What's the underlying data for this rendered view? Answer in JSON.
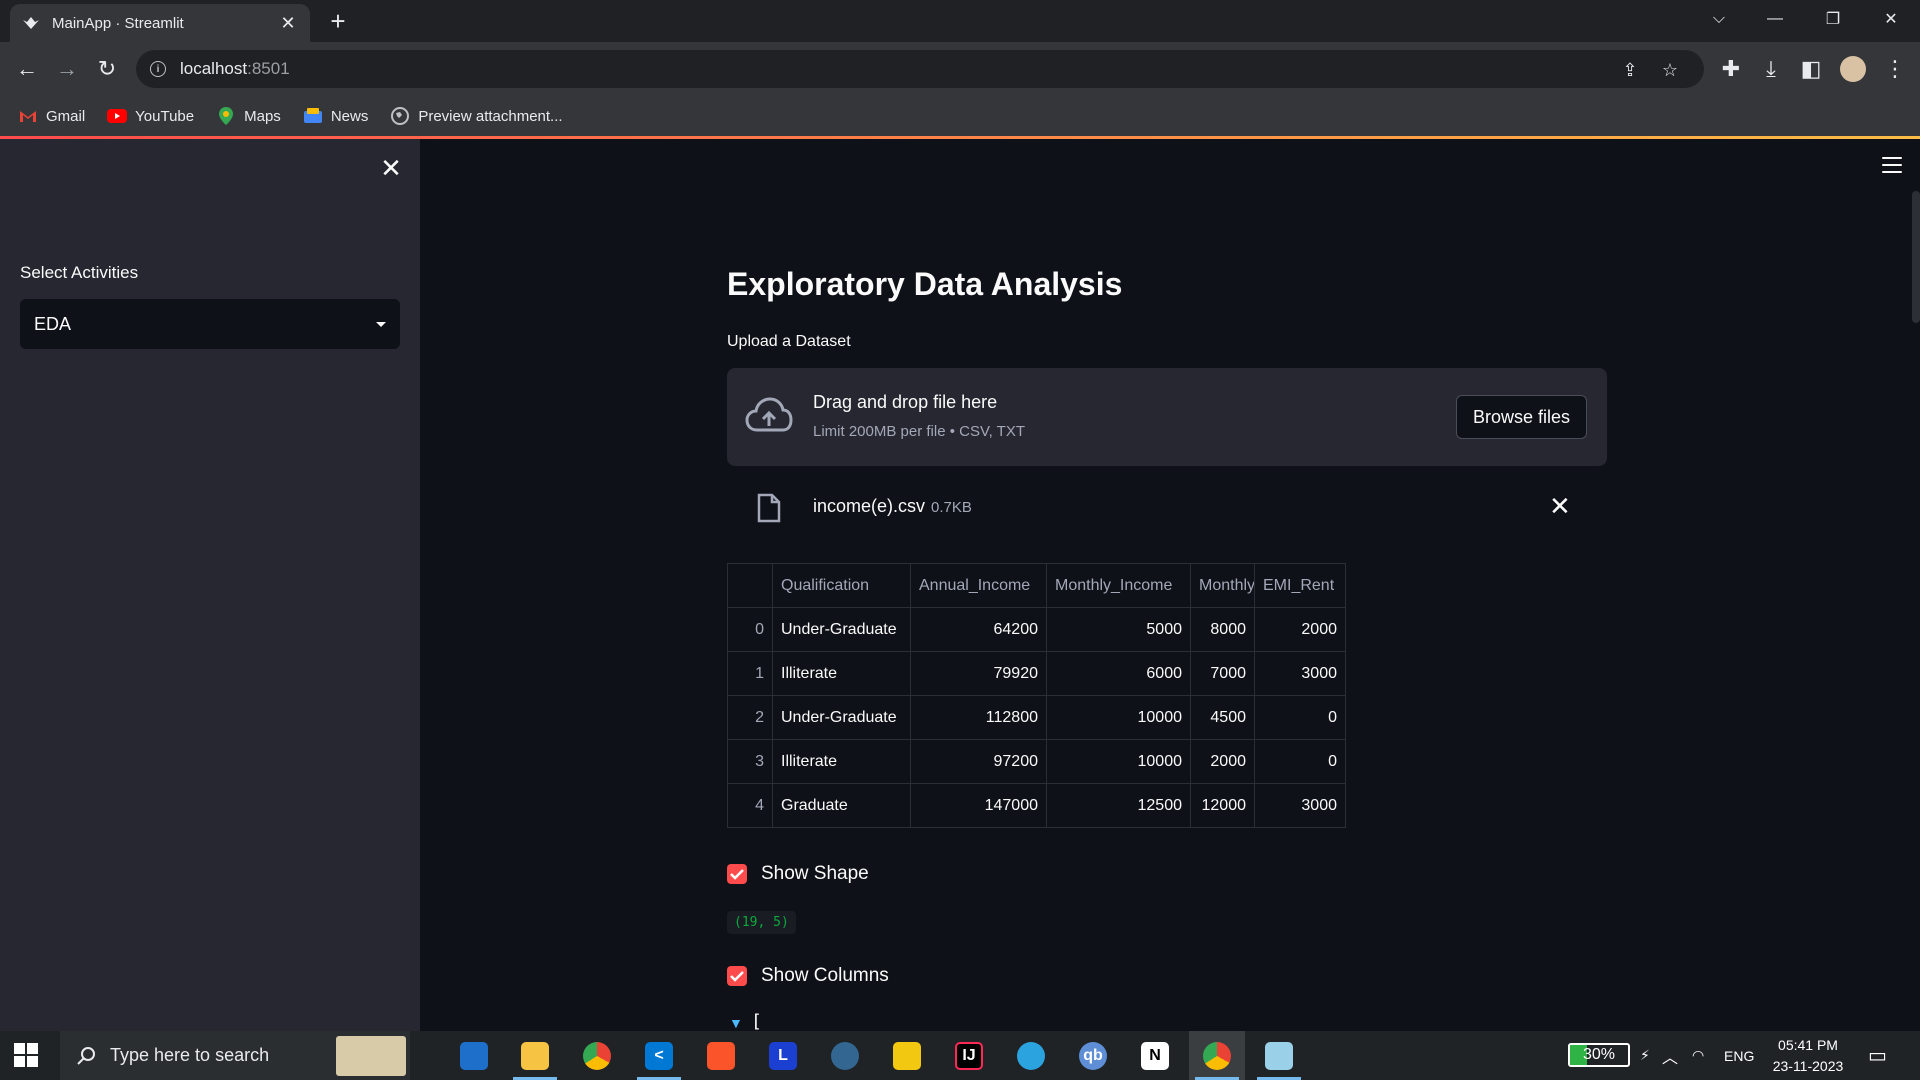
{
  "browser": {
    "tab_title": "MainApp · Streamlit",
    "url_host": "localhost",
    "url_port": ":8501",
    "bookmarks": [
      {
        "label": "Gmail",
        "icon": "gmail-icon"
      },
      {
        "label": "YouTube",
        "icon": "youtube-icon"
      },
      {
        "label": "Maps",
        "icon": "maps-icon"
      },
      {
        "label": "News",
        "icon": "news-icon"
      },
      {
        "label": "Preview attachment...",
        "icon": "globe-icon"
      }
    ]
  },
  "sidebar": {
    "select_label": "Select Activities",
    "select_value": "EDA"
  },
  "main": {
    "title": "Exploratory Data Analysis",
    "upload_label": "Upload a Dataset",
    "dropzone": {
      "main_text": "Drag and drop file here",
      "sub_text": "Limit 200MB per file • CSV, TXT",
      "browse_label": "Browse files"
    },
    "file": {
      "name": "income(e).csv",
      "size": "0.7KB"
    },
    "table": {
      "columns": [
        "",
        "Qualification",
        "Annual_Income",
        "Monthly_Income",
        "Monthly",
        "EMI_Rent"
      ],
      "rows": [
        [
          "0",
          "Under-Graduate",
          "64200",
          "5000",
          "8000",
          "2000"
        ],
        [
          "1",
          "Illiterate",
          "79920",
          "6000",
          "7000",
          "3000"
        ],
        [
          "2",
          "Under-Graduate",
          "112800",
          "10000",
          "4500",
          "0"
        ],
        [
          "3",
          "Illiterate",
          "97200",
          "10000",
          "2000",
          "0"
        ],
        [
          "4",
          "Graduate",
          "147000",
          "12500",
          "12000",
          "3000"
        ]
      ]
    },
    "show_shape_label": "Show Shape",
    "shape_output": "(19, 5)",
    "show_columns_label": "Show Columns",
    "columns_output_start": "["
  },
  "taskbar": {
    "search_placeholder": "Type here to search",
    "battery": "30%",
    "battery_level": 0.3,
    "language": "ENG",
    "time": "05:41 PM",
    "date": "23-11-2023"
  },
  "colors": {
    "accent": "#ff4b4b",
    "app_bg": "#0e1117",
    "sidebar_bg": "#262730",
    "code_green": "#09ab3b"
  }
}
